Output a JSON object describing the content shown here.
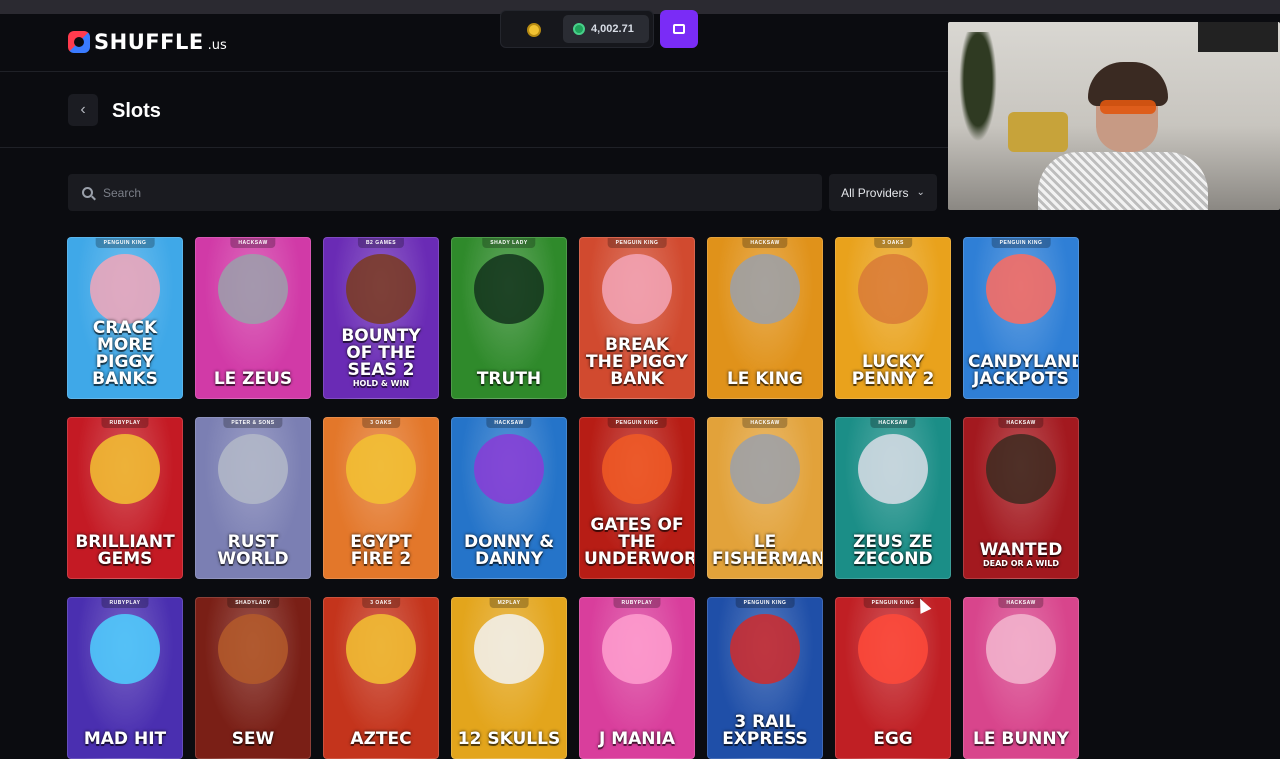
{
  "brand": {
    "name": "SHUFFLE",
    "suffix": ".us"
  },
  "wallet": {
    "balance": "4,002.71"
  },
  "page": {
    "title": "Slots"
  },
  "search": {
    "placeholder": "Search"
  },
  "filters": {
    "providers_label": "All Providers"
  },
  "games": [
    {
      "name": "Crack More Piggy Banks",
      "provider": "PENGUIN KING",
      "bg": "#3fa8e8",
      "art": "#f3a6b8"
    },
    {
      "name": "Le Zeus",
      "provider": "HACKSAW",
      "bg": "#d13aa7",
      "art": "#9aa0aa"
    },
    {
      "name": "Bounty of the Seas 2",
      "sub": "HOLD & WIN",
      "provider": "B2 GAMES",
      "bg": "#6a2bb5",
      "art": "#7a3b1f"
    },
    {
      "name": "Truth",
      "provider": "SHADY LADY",
      "bg": "#2f8a2b",
      "art": "#13321c"
    },
    {
      "name": "Break the Piggy Bank",
      "provider": "PENGUIN KING",
      "bg": "#d14a2f",
      "art": "#f3a6b8"
    },
    {
      "name": "Le King",
      "provider": "HACKSAW",
      "bg": "#e0921a",
      "art": "#9aa0aa"
    },
    {
      "name": "Lucky Penny 2",
      "provider": "3 OAKS",
      "bg": "#e9a21c",
      "art": "#d97a37"
    },
    {
      "name": "Candyland Jackpots",
      "provider": "PENGUIN KING",
      "bg": "#2f7fd6",
      "art": "#ff6b5e"
    },
    {
      "name": "Brilliant Gems",
      "provider": "RUBYPLAY",
      "bg": "#c41a24",
      "art": "#f2c232"
    },
    {
      "name": "Rust World",
      "provider": "PETER & SONS",
      "bg": "#7b7fb3",
      "art": "#b3b8c8"
    },
    {
      "name": "Egypt Fire 2",
      "provider": "3 OAKS",
      "bg": "#e3772a",
      "art": "#f2c232"
    },
    {
      "name": "Donny & Danny",
      "provider": "HACKSAW",
      "bg": "#2574c9",
      "art": "#8a3bd6"
    },
    {
      "name": "Gates of the Underworld",
      "provider": "PENGUIN KING",
      "bg": "#b71d15",
      "art": "#f15a24"
    },
    {
      "name": "Le Fisherman",
      "provider": "HACKSAW",
      "bg": "#e2a23a",
      "art": "#9aa0aa"
    },
    {
      "name": "Zeus ze Zecond",
      "provider": "HACKSAW",
      "bg": "#1b8e87",
      "art": "#d9dde6"
    },
    {
      "name": "Wanted",
      "sub": "DEAD OR A WILD",
      "provider": "HACKSAW",
      "bg": "#a3191f",
      "art": "#3c2a20"
    },
    {
      "name": "Mad Hit",
      "provider": "RUBYPLAY",
      "bg": "#4a2fb0",
      "art": "#4fd1ff"
    },
    {
      "name": "Sew",
      "provider": "SHADYLADY",
      "bg": "#7a1f16",
      "art": "#b45a2a"
    },
    {
      "name": "Aztec",
      "provider": "3 OAKS",
      "bg": "#c4341c",
      "art": "#f2c232"
    },
    {
      "name": "12 Skulls",
      "provider": "M2PLAY",
      "bg": "#e3a51c",
      "art": "#f2f2f2"
    },
    {
      "name": "J Mania",
      "provider": "RUBYPLAY",
      "bg": "#d93e9c",
      "art": "#ff9fcf"
    },
    {
      "name": "3 Rail Express",
      "provider": "PENGUIN KING",
      "bg": "#1f4fa8",
      "art": "#d12a2a"
    },
    {
      "name": "Egg",
      "provider": "PENGUIN KING",
      "bg": "#c01f24",
      "art": "#ff4a3a"
    },
    {
      "name": "Le Bunny",
      "provider": "HACKSAW",
      "bg": "#d8458c",
      "art": "#f3b6cf"
    }
  ]
}
